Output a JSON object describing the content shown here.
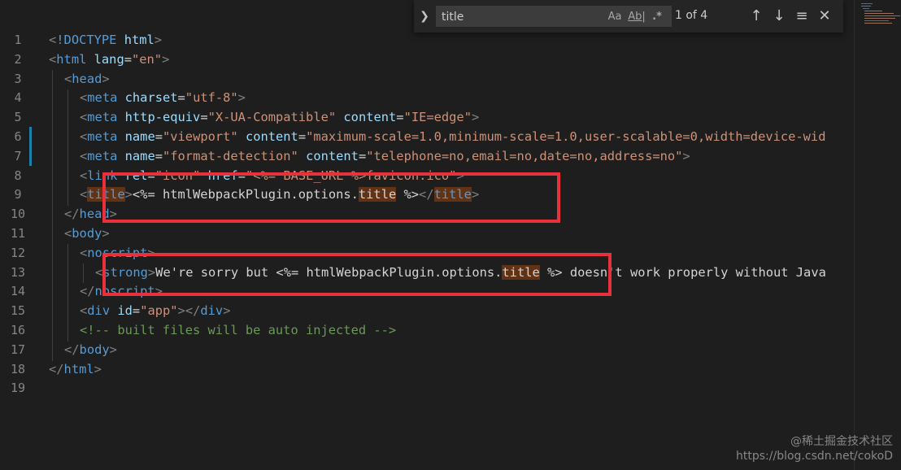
{
  "find_widget": {
    "toggle_icon": "chevron-right-icon",
    "query": "title",
    "match_case_label": "Aa",
    "whole_word_label": "Ab|",
    "regex_label": ".*",
    "match_count": "1 of 4"
  },
  "line_numbers": [
    "1",
    "2",
    "3",
    "4",
    "5",
    "6",
    "7",
    "8",
    "9",
    "10",
    "11",
    "12",
    "13",
    "14",
    "15",
    "16",
    "17",
    "18",
    "19"
  ],
  "code": {
    "l1": {
      "lt": "<",
      "bang": "!DOCTYPE",
      "sp": " ",
      "html": "html",
      "gt": ">"
    },
    "l2": {
      "lt": "<",
      "tag": "html",
      "sp": " ",
      "attr": "lang",
      "eq": "=",
      "val": "\"en\"",
      "gt": ">"
    },
    "l3": {
      "lt": "<",
      "tag": "head",
      "gt": ">"
    },
    "l4": {
      "lt": "<",
      "tag": "meta",
      "sp": " ",
      "attr": "charset",
      "eq": "=",
      "val": "\"utf-8\"",
      "gt": ">"
    },
    "l5": {
      "lt": "<",
      "tag": "meta",
      "sp": " ",
      "attr1": "http-equiv",
      "eq1": "=",
      "val1": "\"X-UA-Compatible\"",
      "sp2": " ",
      "attr2": "content",
      "eq2": "=",
      "val2": "\"IE=edge\"",
      "gt": ">"
    },
    "l6": {
      "lt": "<",
      "tag": "meta",
      "sp": " ",
      "attr1": "name",
      "eq1": "=",
      "val1": "\"viewport\"",
      "sp2": " ",
      "attr2": "content",
      "eq2": "=",
      "val2": "\"maximum-scale=1.0,minimum-scale=1.0,user-scalable=0,width=device-wid"
    },
    "l7": {
      "lt": "<",
      "tag": "meta",
      "sp": " ",
      "attr1": "name",
      "eq1": "=",
      "val1": "\"format-detection\"",
      "sp2": " ",
      "attr2": "content",
      "eq2": "=",
      "val2": "\"telephone=no,email=no,date=no,address=no\"",
      "gt": ">"
    },
    "l8": {
      "lt": "<",
      "tag": "link",
      "sp": " ",
      "attr1": "rel",
      "eq1": "=",
      "val1": "\"icon\"",
      "sp2": " ",
      "attr2": "href",
      "eq2": "=",
      "val2": "\"<%= BASE_URL %>favicon.ico\"",
      "gt": ">"
    },
    "l9": {
      "lt": "<",
      "tag": "title",
      "gt": ">",
      "text1": "<%= htmlWebpackPlugin.options.",
      "match": "title",
      "text2": " %>",
      "lt2": "</",
      "tag2": "title",
      "gt2": ">"
    },
    "l10": {
      "lt": "</",
      "tag": "head",
      "gt": ">"
    },
    "l11": {
      "lt": "<",
      "tag": "body",
      "gt": ">"
    },
    "l12": {
      "lt": "<",
      "tag": "noscript",
      "gt": ">"
    },
    "l13": {
      "lt": "<",
      "tag": "strong",
      "gt": ">",
      "text1": "We're sorry but <%= htmlWebpackPlugin.options.",
      "match": "title",
      "text2": " %> doesn't work properly without Java"
    },
    "l14": {
      "lt": "</",
      "tag": "noscript",
      "gt": ">"
    },
    "l15": {
      "lt": "<",
      "tag": "div",
      "sp": " ",
      "attr": "id",
      "eq": "=",
      "val": "\"app\"",
      "gt": ">",
      "lt2": "</",
      "tag2": "div",
      "gt2": ">"
    },
    "l16": {
      "comment": "<!-- built files will be auto injected -->"
    },
    "l17": {
      "lt": "</",
      "tag": "body",
      "gt": ">"
    },
    "l18": {
      "lt": "</",
      "tag": "html",
      "gt": ">"
    }
  },
  "watermark": {
    "line1": "@稀土掘金技术社区",
    "line2": "https://blog.csdn.net/cokoD"
  },
  "colors": {
    "background": "#1e1e1e",
    "tag": "#569cd6",
    "attribute": "#9cdcfe",
    "string": "#ce9178",
    "comment": "#6a9955",
    "find_match_highlight": "#613214",
    "annotation_box": "#e8313a"
  }
}
